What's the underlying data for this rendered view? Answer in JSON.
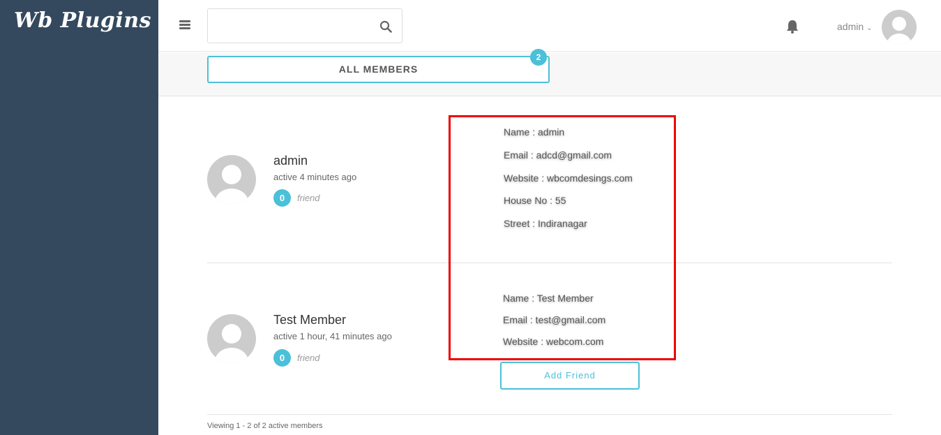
{
  "brand": {
    "logo_text": "Wb Plugins"
  },
  "header": {
    "search": {
      "placeholder": "",
      "value": ""
    },
    "user": {
      "name": "admin"
    }
  },
  "tabs": {
    "all_members": {
      "label": "ALL MEMBERS",
      "count": "2"
    }
  },
  "members": [
    {
      "name": "admin",
      "last_active": "active 4 minutes ago",
      "friend_count": "0",
      "friend_label": "friend",
      "profile": [
        "Name : admin",
        "Email : adcd@gmail.com",
        "Website : wbcomdesings.com",
        "House No : 55",
        "Street : Indiranagar"
      ]
    },
    {
      "name": "Test Member",
      "last_active": "active 1 hour, 41 minutes ago",
      "friend_count": "0",
      "friend_label": "friend",
      "profile": [
        "Name : Test Member",
        "Email : test@gmail.com",
        "Website : webcom.com"
      ],
      "action_label": "Add Friend"
    }
  ],
  "footer": {
    "pagination_text": "Viewing 1 - 2 of 2 active members"
  },
  "colors": {
    "sidebar": "#34495e",
    "accent": "#4bc0d9",
    "highlight": "#ee0000"
  }
}
